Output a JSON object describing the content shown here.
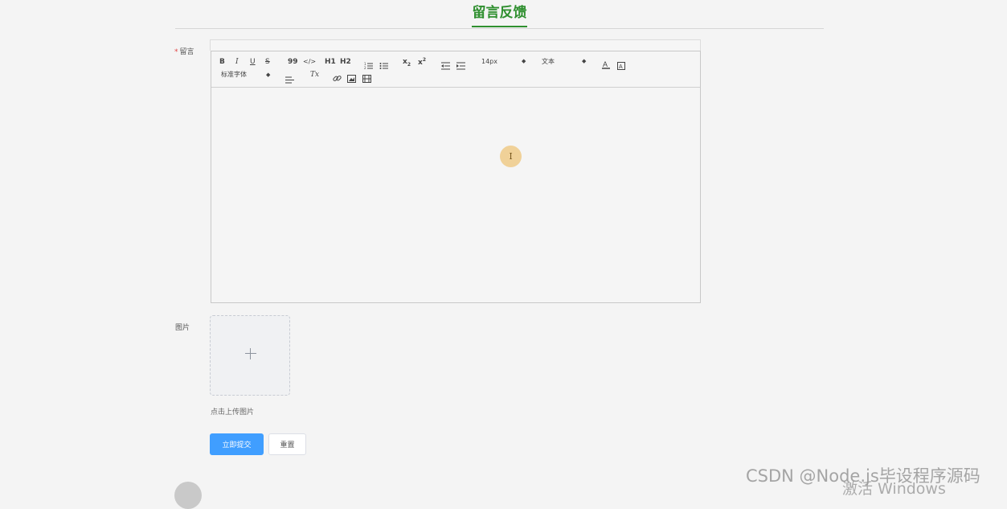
{
  "header": {
    "title": "留言反馈"
  },
  "form": {
    "message_label": "留言",
    "required_mark": "*",
    "image_label": "图片",
    "upload_tip": "点击上传图片",
    "submit_label": "立即提交",
    "reset_label": "重置"
  },
  "toolbar": {
    "bold": "B",
    "italic": "I",
    "underline": "U",
    "strike": "S",
    "blockquote": "99",
    "code": "</>",
    "h1": "H1",
    "h2": "H2",
    "subscript": "x",
    "superscript": "x",
    "size_value": "14px",
    "header_value": "文本",
    "font_value": "标准字体",
    "clean": "Tx"
  },
  "cursor": {
    "glyph": "I"
  },
  "watermarks": {
    "csdn": "CSDN @Node.js毕设程序源码",
    "windows": "激活 Windows"
  },
  "colors": {
    "accent": "#2f8f2f",
    "primary_button": "#409eff",
    "required": "#e04545"
  }
}
